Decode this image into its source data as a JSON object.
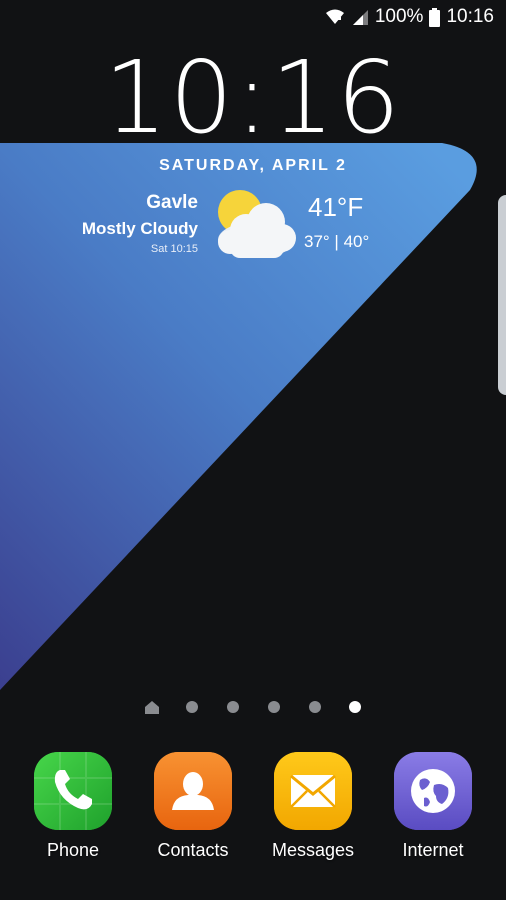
{
  "status_bar": {
    "battery": "100%",
    "time": "10:16",
    "icons": [
      "wifi-icon",
      "signal-icon",
      "battery-icon"
    ]
  },
  "lockscreen": {
    "clock": "10:16",
    "date": "SATURDAY, APRIL 2"
  },
  "weather": {
    "city": "Gavle",
    "condition": "Mostly Cloudy",
    "updated": "Sat 10:15",
    "temperature": "41°F",
    "range": "37° | 40°",
    "icon": "partly-cloudy-icon"
  },
  "pages": {
    "count": 6,
    "active_index": 5,
    "first_is_home": true
  },
  "dock": {
    "apps": [
      {
        "label": "Phone",
        "icon": "phone-icon",
        "color": "#2fbe3a"
      },
      {
        "label": "Contacts",
        "icon": "contacts-icon",
        "color": "#f07a1f"
      },
      {
        "label": "Messages",
        "icon": "messages-icon",
        "color": "#f7b500"
      },
      {
        "label": "Internet",
        "icon": "internet-icon",
        "color": "#6b5fd0"
      }
    ]
  },
  "colors": {
    "background": "#111214",
    "wallpaper_blue": "#4f8fd0",
    "wallpaper_purple": "#3a3f8a"
  }
}
